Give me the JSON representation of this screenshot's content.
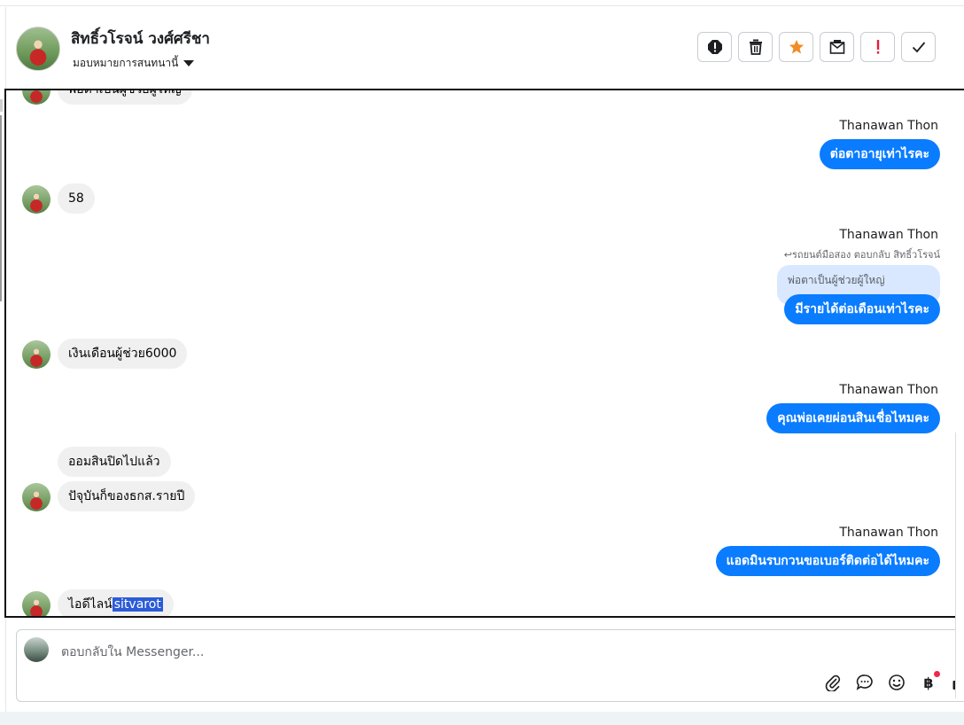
{
  "header": {
    "contact_name": "สิทธิ์วโรจน์ วงศ์ศรีชา",
    "assign_label": "มอบหมายการสนทนานี้"
  },
  "toolbar": {
    "buttons": [
      {
        "name": "spam-icon"
      },
      {
        "name": "trash-icon"
      },
      {
        "name": "star-icon",
        "color": "#f28c28"
      },
      {
        "name": "mark-unread-icon"
      },
      {
        "name": "important-icon",
        "color": "#e41e3f"
      },
      {
        "name": "done-check-icon"
      }
    ]
  },
  "conversation": {
    "agent_name": "Thanawan Thon",
    "messages": [
      {
        "from": "customer",
        "text": "พ่อตาเป็นผู้ช่วยผู้ใหญ่"
      },
      {
        "from": "agent",
        "text": "ต่อตาอายุเท่าไรคะ"
      },
      {
        "from": "customer",
        "text": "58"
      },
      {
        "from": "agent",
        "reply_note": "↩รถยนต์มือสอง ตอบกลับ สิทธิ์วโรจน์",
        "quote": "พ่อตาเป็นผู้ช่วยผู้ใหญ่",
        "text": "มีรายได้ต่อเดือนเท่าไรคะ"
      },
      {
        "from": "customer",
        "text": "เงินเดือนผู้ช่วย6000"
      },
      {
        "from": "agent",
        "text": "คุณพ่อเคยผ่อนสินเชื่อไหมคะ"
      },
      {
        "from": "customer",
        "text": "ออมสินปิดไปแล้ว"
      },
      {
        "from": "customer",
        "text": "ปัจุบันก็ของธกส.รายปี"
      },
      {
        "from": "agent",
        "text": "แอดมินรบกวนขอเบอร์ติดต่อได้ไหมคะ"
      },
      {
        "from": "customer",
        "text_prefix": "ไอดีไลน์",
        "text_highlight": "sitvarot"
      }
    ]
  },
  "composer": {
    "placeholder": "ตอบกลับใน Messenger...",
    "currency_symbol": "฿",
    "accent": "#0a7cff"
  }
}
